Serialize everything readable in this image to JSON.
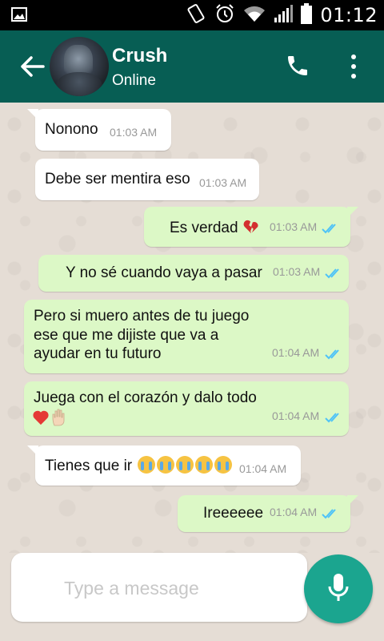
{
  "status_bar": {
    "time": "01:12"
  },
  "header": {
    "name": "Crush",
    "status": "Online"
  },
  "messages": [
    {
      "text": "Nonono",
      "time": "01:03 AM"
    },
    {
      "text": "Debe ser mentira eso",
      "time": "01:03 AM"
    },
    {
      "text": "Es verdad",
      "time": "01:03 AM",
      "emoji": "broken-heart"
    },
    {
      "text": "Y no sé cuando vaya a pasar",
      "time": "01:03 AM"
    },
    {
      "line1": "Pero si muero antes de tu juego",
      "line2": "ese que me dijiste que va a",
      "line3": "ayudar en tu futuro",
      "time": "01:04 AM"
    },
    {
      "text": "Juega con el corazón y dalo todo",
      "time": "01:04 AM",
      "emojis": [
        "red-heart",
        "raised-hand"
      ]
    },
    {
      "text": "Tienes que ir",
      "time": "01:04 AM",
      "emojis": [
        "crying-face",
        "crying-face",
        "crying-face",
        "crying-face",
        "crying-face"
      ]
    },
    {
      "text": "Ireeeeee",
      "time": "01:04 AM"
    }
  ],
  "composer": {
    "placeholder": "Type a message"
  },
  "colors": {
    "header": "#075e54",
    "outgoing": "#dcf8c6",
    "incoming": "#ffffff",
    "mic": "#1ba58f",
    "read_ticks": "#4fc3f7"
  }
}
